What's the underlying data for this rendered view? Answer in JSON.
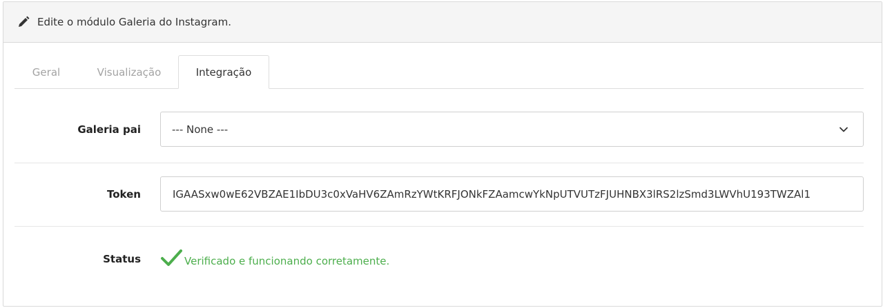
{
  "header": {
    "title": "Edite o módulo Galeria do Instagram.",
    "icon": "pencil-icon"
  },
  "tabs": [
    {
      "label": "Geral",
      "active": false
    },
    {
      "label": "Visualização",
      "active": false
    },
    {
      "label": "Integração",
      "active": true
    }
  ],
  "form": {
    "parent_gallery": {
      "label": "Galeria pai",
      "selected": "--- None ---",
      "icon": "chevron-down-icon"
    },
    "token": {
      "label": "Token",
      "value": "IGAASxw0wE62VBZAE1IbDU3c0xVaHV6ZAmRzYWtKRFJONkFZAamcwYkNpUTVUTzFJUHNBX3lRS2lzSmd3LWVhU193TWZAl1"
    },
    "status": {
      "label": "Status",
      "text": "Verificado e funcionando corretamente.",
      "icon": "check-icon"
    }
  },
  "colors": {
    "success": "#4cae4c",
    "heading_bg": "#f5f5f5",
    "inactive_tab": "#a3a3a3"
  }
}
